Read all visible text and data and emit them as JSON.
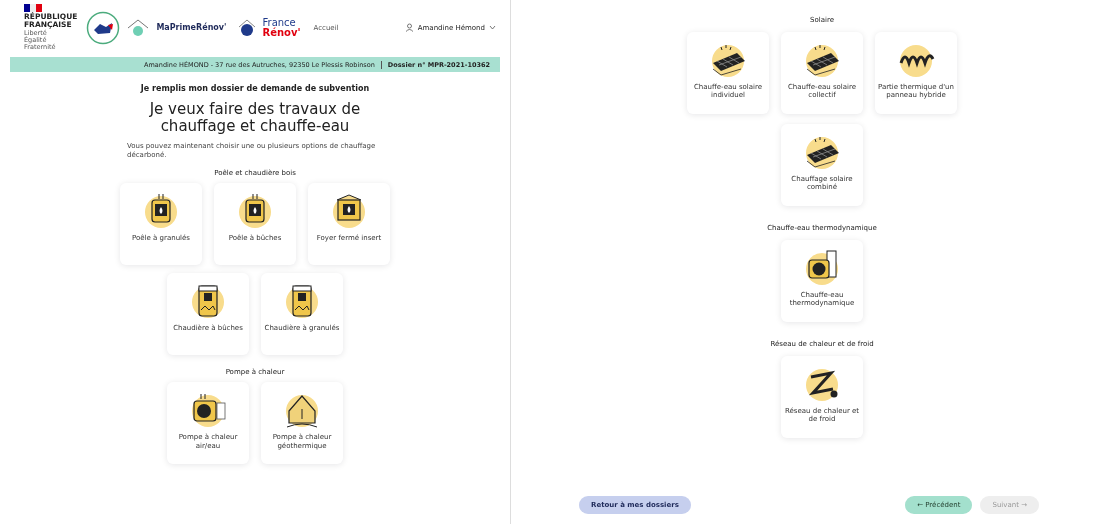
{
  "header": {
    "republic": "RÉPUBLIQUE\nFRANÇAISE",
    "motto": "Liberté\nÉgalité\nFraternité",
    "brand": "MaPrimeRénov'",
    "france": "France",
    "renov": "Rénov'",
    "nav_link": "Accueil",
    "user": "Amandine Hémond"
  },
  "info_bar": {
    "owner": "Amandine HÉMOND - 37 rue des Autruches, 92350 Le Plessis Robinson",
    "dossier": "Dossier n° MPR-2021-10362"
  },
  "form": {
    "step_title": "Je remplis mon dossier de demande de subvention",
    "title": "Je veux faire des travaux de chauffage et chauffe-eau",
    "description": "Vous pouvez maintenant choisir une ou plusieurs options de chauffage décarboné."
  },
  "left_sections": [
    {
      "title": "Poêle et chaudière bois",
      "rows": [
        [
          {
            "label": "Poêle à granulés",
            "kind": "stove"
          },
          {
            "label": "Poêle à bûches",
            "kind": "stove"
          },
          {
            "label": "Foyer fermé insert",
            "kind": "insert"
          }
        ],
        [
          {
            "label": "Chaudière à bûches",
            "kind": "boiler"
          },
          {
            "label": "Chaudière à granulés",
            "kind": "boiler"
          }
        ]
      ]
    },
    {
      "title": "Pompe à chaleur",
      "rows": [
        [
          {
            "label": "Pompe à chaleur air/eau",
            "kind": "heatpump"
          },
          {
            "label": "Pompe à chaleur géothermique",
            "kind": "house"
          }
        ]
      ]
    }
  ],
  "right_sections": [
    {
      "title": "Solaire",
      "rows": [
        [
          {
            "label": "Chauffe-eau solaire individuel",
            "kind": "solar"
          },
          {
            "label": "Chauffe-eau solaire collectif",
            "kind": "solar"
          },
          {
            "label": "Partie thermique d'un panneau hybride",
            "kind": "coil"
          }
        ],
        [
          "",
          {
            "label": "Chauffage solaire combiné",
            "kind": "solar"
          },
          ""
        ]
      ]
    },
    {
      "title": "Chauffe-eau thermodynamique",
      "rows": [
        [
          {
            "label": "Chauffe-eau thermodynamique",
            "kind": "thermo"
          }
        ]
      ]
    },
    {
      "title": "Réseau de chaleur et de froid",
      "rows": [
        [
          {
            "label": "Réseau de chaleur et de froid",
            "kind": "network"
          }
        ]
      ]
    }
  ],
  "buttons": [
    {
      "label": "Retour à mes dossiers",
      "kind": "back",
      "disabled": false
    },
    {
      "label": "← Précédent",
      "kind": "previous",
      "disabled": false
    },
    {
      "label": "Suivant →",
      "kind": "next",
      "disabled": true
    }
  ]
}
